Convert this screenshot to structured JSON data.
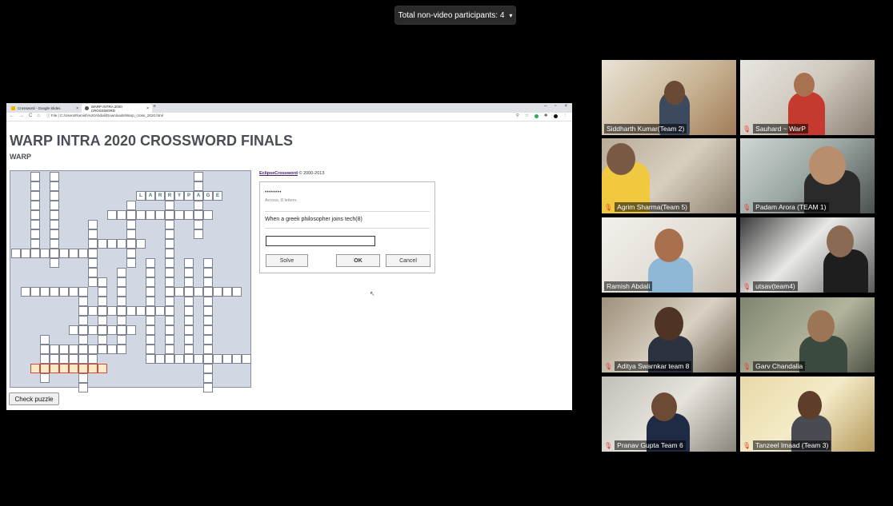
{
  "meeting": {
    "participants_label": "Total non-video participants: 4",
    "participants_caret": "▾"
  },
  "browser": {
    "tabs": [
      {
        "title": "Crossword - Google Slides",
        "close": "×",
        "icon_color": "#f4b400",
        "active": false
      },
      {
        "title": "WARP INTRA 2020 CROSSWORD",
        "close": "×",
        "icon_color": "#555555",
        "active": true
      }
    ],
    "new_tab": "+",
    "window_controls": [
      "–",
      "▫",
      "×"
    ],
    "nav": [
      "←",
      "→",
      "C",
      "⌂"
    ],
    "address": "ⓘ File | C:/Users/Ramish%20Abdali/Downloads/Warp_cross_2020.html",
    "toolbar_icons": [
      "search-icon",
      "star-icon",
      "extension-icon",
      "puzzle-icon",
      "profile-icon",
      "menu-icon"
    ]
  },
  "page": {
    "title": "WARP INTRA 2020 CROSSWORD FINALS",
    "subtitle": "WARP",
    "check_button": "Check puzzle",
    "credit_link": "EclipseCrossword",
    "credit_rest": " © 2000-2013"
  },
  "crossword": {
    "filled_word": [
      "L",
      "A",
      "R",
      "R",
      "Y",
      "P",
      "A",
      "G",
      "E"
    ],
    "highlight_color": "#fdebc8"
  },
  "clue": {
    "mask": "••••••••",
    "meta": "Across, 8 letters.",
    "text": "When a greek philosopher joins tech(8)",
    "input_value": "",
    "buttons": {
      "solve": "Solve",
      "ok": "OK",
      "cancel": "Cancel"
    }
  },
  "participants": [
    {
      "name": "Siddharth Kumar(Team 2)",
      "muted": false
    },
    {
      "name": "Sauhard ~ WarP",
      "muted": true
    },
    {
      "name": "Agrim Sharma(Team 5)",
      "muted": true
    },
    {
      "name": "Padam Arora (TEAM 1)",
      "muted": true
    },
    {
      "name": "Ramish Abdali",
      "muted": false,
      "active": true
    },
    {
      "name": "utsav(team4)",
      "muted": true
    },
    {
      "name": "Aditya Swarnkar team 8",
      "muted": true
    },
    {
      "name": "Garv Chandalia",
      "muted": true
    },
    {
      "name": "Pranav Gupta Team 6",
      "muted": true
    },
    {
      "name": "Tanzeel Imaad (Team 3)",
      "muted": true
    }
  ]
}
